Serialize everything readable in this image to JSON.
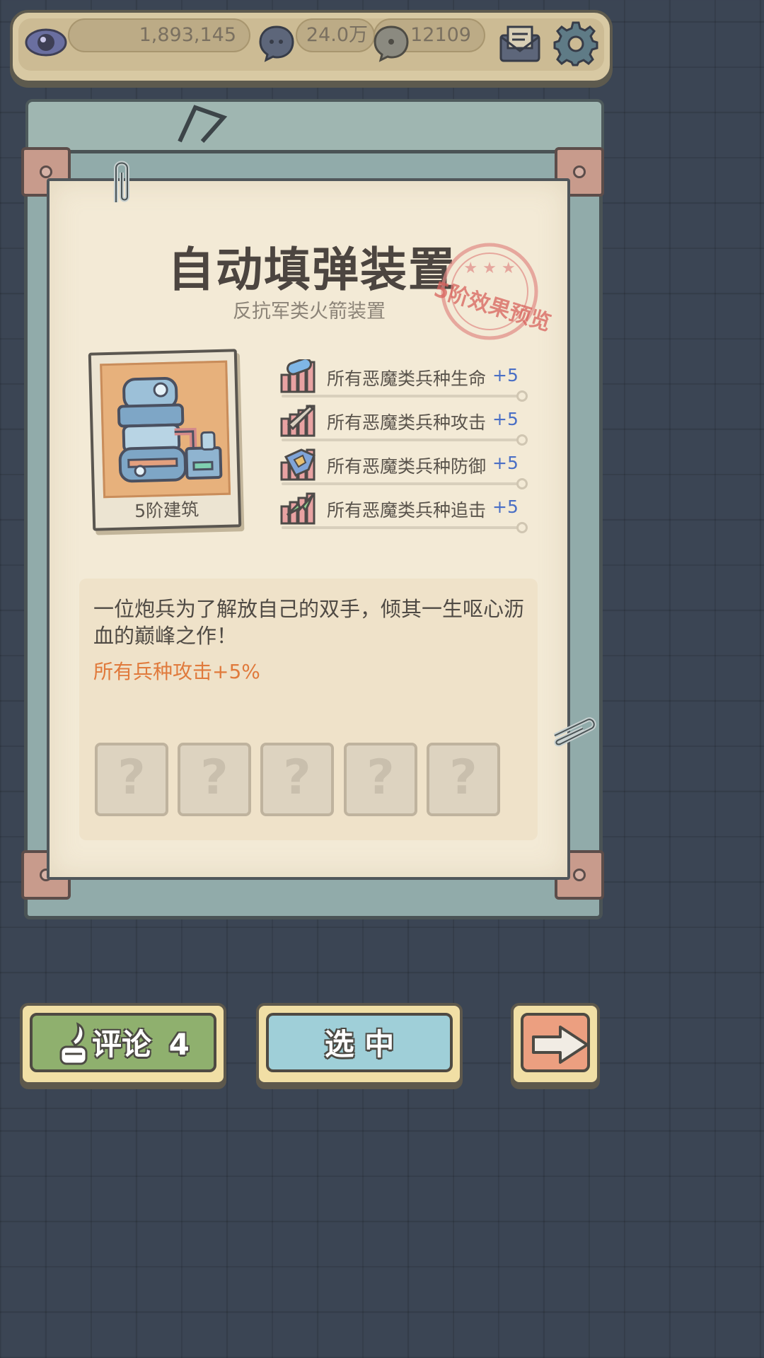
{
  "topbar": {
    "views": "1,893,145",
    "comments": "24.0万",
    "messages": "12109"
  },
  "building": {
    "title": "自动填弹装置",
    "subtitle": "反抗军类火箭装置",
    "stamp": "5阶效果预览",
    "card_label": "5阶建筑"
  },
  "stats": [
    {
      "label": "所有恶魔类兵种生命",
      "value": "+5",
      "icon": "health-icon"
    },
    {
      "label": "所有恶魔类兵种攻击",
      "value": "+5",
      "icon": "sword-icon"
    },
    {
      "label": "所有恶魔类兵种防御",
      "value": "+5",
      "icon": "shield-icon"
    },
    {
      "label": "所有恶魔类兵种追击",
      "value": "+5",
      "icon": "lightning-icon"
    }
  ],
  "description": {
    "text": "一位炮兵为了解放自己的双手，倾其一生呕心沥血的巅峰之作！",
    "bonus": "所有兵种攻击+5%"
  },
  "slots": [
    "?",
    "?",
    "?",
    "?",
    "?"
  ],
  "buttons": {
    "comment_label": "评论",
    "comment_count": "4",
    "select_label": "选 中"
  },
  "colors": {
    "stat_value": "#4a6fc5",
    "bonus_text": "#e07a3c",
    "stamp": "#d8625c",
    "comment_button": "#8fb06e",
    "select_button": "#9fcfd8",
    "next_button": "#ec9f80"
  }
}
